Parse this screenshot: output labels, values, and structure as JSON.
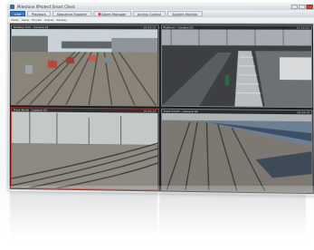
{
  "window": {
    "title": "Milestone XProtect Smart Client"
  },
  "toolbar": {
    "tabs": [
      {
        "label": "Live"
      },
      {
        "label": "Playback"
      },
      {
        "label": "Sequence Explorer"
      },
      {
        "label": "Alarm Manager"
      },
      {
        "label": "Access Control"
      },
      {
        "label": "System Monitor"
      }
    ]
  },
  "subbar": {
    "items": [
      "Views",
      "Setup",
      "Private",
      "Shared",
      "Railway"
    ]
  },
  "cameras": [
    {
      "title": "Railway Yard - Camera 01",
      "time": "10:24:15"
    },
    {
      "title": "Platform - Camera 02",
      "time": "10:24:15"
    },
    {
      "title": "Track North - Camera 03",
      "time": "10:24:15"
    },
    {
      "title": "Track South - Camera 04",
      "time": "10:24:15"
    }
  ],
  "colors": {
    "accent": "#3a7cc9",
    "alarm": "#d2362b",
    "selected_border": "#c8312a"
  }
}
